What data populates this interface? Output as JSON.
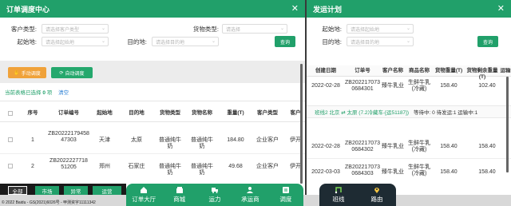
{
  "left": {
    "title": "订单调度中心",
    "filters": {
      "customer_type_label": "客户类型:",
      "customer_type_placeholder": "请选择客户类型",
      "goods_type_label": "货物类型:",
      "goods_type_placeholder": "请选择",
      "origin_label": "起始地:",
      "origin_placeholder": "请选择起始地",
      "dest_label": "目的地:",
      "dest_placeholder": "请选择目的地",
      "query_label": "查询"
    },
    "actions": {
      "manual": "手动调度",
      "auto": "自动调度"
    },
    "selection": {
      "prefix": "当前表格已选择",
      "count": "0",
      "unit": "项",
      "clear": "清空"
    },
    "columns": [
      "序号",
      "订单编号",
      "起始地",
      "目的地",
      "货物类型",
      "货物名称",
      "重量(T)",
      "客户类型",
      "客户"
    ],
    "rows": [
      {
        "index": "1",
        "order_no": "ZB2022217945847303",
        "origin": "天津",
        "dest": "太原",
        "goods_type": "普通纯牛奶",
        "goods_name": "普通纯牛奶",
        "weight": "184.80",
        "customer_type": "企业客户",
        "customer": "伊开"
      },
      {
        "index": "2",
        "order_no": "ZB2022227718 51205",
        "origin": "郑州",
        "dest": "石家庄",
        "goods_type": "普通纯牛奶",
        "goods_name": "普通纯牛奶",
        "weight": "49.68",
        "customer_type": "企业客户",
        "customer": "伊开"
      }
    ]
  },
  "right": {
    "title": "发运计划",
    "filters": {
      "origin_label": "起始地:",
      "origin_placeholder": "请选择起始地",
      "dest_label": "目的地:",
      "dest_placeholder": "请选择目的地",
      "query_label": "查询"
    },
    "columns": [
      "创建日期",
      "订单号",
      "客户名称",
      "商品名称",
      "货物重量(T)",
      "货物剩余重量(T)",
      "运输"
    ],
    "rows": [
      {
        "date": "2022-02-28",
        "order_no": "ZB2022170730684301",
        "customer": "臻牛乳业",
        "goods": "生鲜牛乳(冷藏)",
        "weight": "158.40",
        "remaining": "102.40"
      }
    ],
    "trip": {
      "route": "班线2 北京 ⇄ 太原 (7.2冷藏车-[运51187])",
      "status": "等待中: 0 待发运:1 运输中:1"
    },
    "trip_rows": [
      {
        "date": "2022-02-28",
        "order_no": "ZB2022170730684302",
        "customer": "臻牛乳业",
        "goods": "生鲜牛乳(冷藏)",
        "weight": "158.40",
        "remaining": "158.40"
      },
      {
        "date": "2022-03-03",
        "order_no": "ZB2022170730684303",
        "customer": "臻牛乳业",
        "goods": "生鲜牛乳(冷藏)",
        "weight": "158.40",
        "remaining": "158.40"
      }
    ]
  },
  "bottom_chips": [
    "全部",
    "市场",
    "异常",
    "运营"
  ],
  "nav_left": [
    "订单大厅",
    "商城",
    "运力",
    "承运商",
    "调度"
  ],
  "nav_right": [
    "班线",
    "路由"
  ],
  "copyright": "© 2022 Baidu - GS(2021)6026号 - 甲测资字11111342",
  "colors": {
    "primary": "#21a06a",
    "orange": "#f0a23a",
    "dark": "#1e2b33"
  }
}
